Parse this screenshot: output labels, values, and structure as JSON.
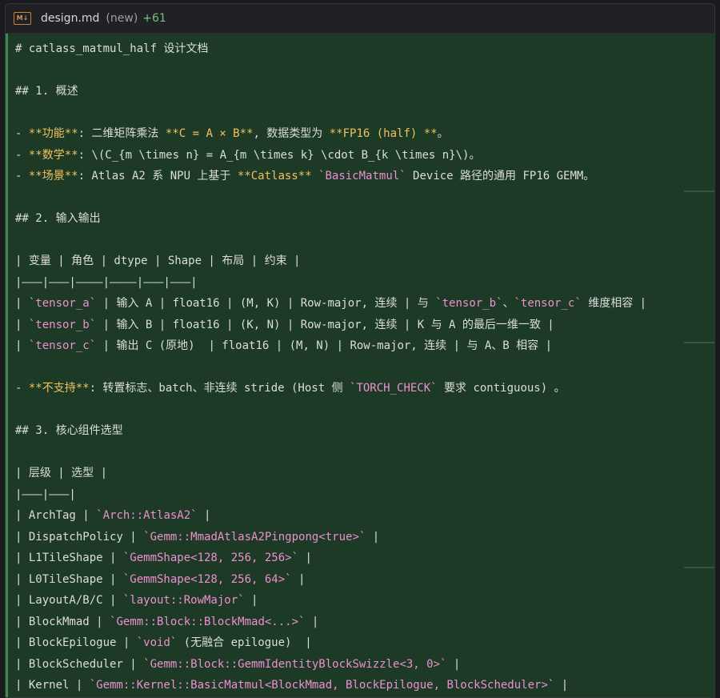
{
  "tab": {
    "filename": "design.md",
    "status": "(new)",
    "added": "+61"
  },
  "lines": [
    [
      {
        "t": "# catlass_matmul_half 设计文档"
      }
    ],
    [],
    [
      {
        "t": "## 1. 概述"
      }
    ],
    [],
    [
      {
        "t": "- "
      },
      {
        "t": "**功能**",
        "s": "b"
      },
      {
        "t": ": 二维矩阵乘法 "
      },
      {
        "t": "**C = A × B**",
        "s": "b"
      },
      {
        "t": ", 数据类型为 "
      },
      {
        "t": "**FP16 (half) **",
        "s": "b"
      },
      {
        "t": "。"
      }
    ],
    [
      {
        "t": "- "
      },
      {
        "t": "**数学**",
        "s": "b"
      },
      {
        "t": ": \\(C_{m \\times n} = A_{m \\times k} \\cdot B_{k \\times n}\\)。"
      }
    ],
    [
      {
        "t": "- "
      },
      {
        "t": "**场景**",
        "s": "b"
      },
      {
        "t": ": Atlas A2 系 NPU 上基于 "
      },
      {
        "t": "**Catlass**",
        "s": "b"
      },
      {
        "t": " "
      },
      {
        "t": "`BasicMatmul`",
        "s": "c"
      },
      {
        "t": " Device 路径的通用 FP16 GEMM。"
      }
    ],
    [],
    [
      {
        "t": "## 2. 输入输出"
      }
    ],
    [],
    [
      {
        "t": "| 变量 | 角色 | dtype | Shape | 布局 | 约束 |"
      }
    ],
    [
      {
        "t": "|———|———|————|————|———|———|"
      }
    ],
    [
      {
        "t": "| "
      },
      {
        "t": "`tensor_a`",
        "s": "c"
      },
      {
        "t": " | 输入 A | float16 | (M, K) | Row-major, 连续 | 与 "
      },
      {
        "t": "`tensor_b`",
        "s": "c"
      },
      {
        "t": "、"
      },
      {
        "t": "`tensor_c`",
        "s": "c"
      },
      {
        "t": " 维度相容 |"
      }
    ],
    [
      {
        "t": "| "
      },
      {
        "t": "`tensor_b`",
        "s": "c"
      },
      {
        "t": " | 输入 B | float16 | (K, N) | Row-major, 连续 | K 与 A 的最后一维一致 |"
      }
    ],
    [
      {
        "t": "| "
      },
      {
        "t": "`tensor_c`",
        "s": "c"
      },
      {
        "t": " | 输出 C (原地)  | float16 | (M, N) | Row-major, 连续 | 与 A、B 相容 |"
      }
    ],
    [],
    [
      {
        "t": "- "
      },
      {
        "t": "**不支持**",
        "s": "b"
      },
      {
        "t": ": 转置标志、batch、非连续 stride (Host 侧 "
      },
      {
        "t": "`TORCH_CHECK`",
        "s": "c"
      },
      {
        "t": " 要求 contiguous) 。"
      }
    ],
    [],
    [
      {
        "t": "## 3. 核心组件选型"
      }
    ],
    [],
    [
      {
        "t": "| 层级 | 选型 |"
      }
    ],
    [
      {
        "t": "|———|———|"
      }
    ],
    [
      {
        "t": "| ArchTag | "
      },
      {
        "t": "`Arch::AtlasA2`",
        "s": "c"
      },
      {
        "t": " |"
      }
    ],
    [
      {
        "t": "| DispatchPolicy | "
      },
      {
        "t": "`Gemm::MmadAtlasA2Pingpong<true>`",
        "s": "c"
      },
      {
        "t": " |"
      }
    ],
    [
      {
        "t": "| L1TileShape | "
      },
      {
        "t": "`GemmShape<128, 256, 256>`",
        "s": "c"
      },
      {
        "t": " |"
      }
    ],
    [
      {
        "t": "| L0TileShape | "
      },
      {
        "t": "`GemmShape<128, 256, 64>`",
        "s": "c"
      },
      {
        "t": " |"
      }
    ],
    [
      {
        "t": "| LayoutA/B/C | "
      },
      {
        "t": "`layout::RowMajor`",
        "s": "c"
      },
      {
        "t": " |"
      }
    ],
    [
      {
        "t": "| BlockMmad | "
      },
      {
        "t": "`Gemm::Block::BlockMmad<...>`",
        "s": "c"
      },
      {
        "t": " |"
      }
    ],
    [
      {
        "t": "| BlockEpilogue | "
      },
      {
        "t": "`void`",
        "s": "c"
      },
      {
        "t": " (无融合 epilogue)  |"
      }
    ],
    [
      {
        "t": "| BlockScheduler | "
      },
      {
        "t": "`Gemm::Block::GemmIdentityBlockSwizzle<3, 0>`",
        "s": "c"
      },
      {
        "t": " |"
      }
    ],
    [
      {
        "t": "| Kernel | "
      },
      {
        "t": "`Gemm::Kernel::BasicMatmul<BlockMmad, BlockEpilogue, BlockScheduler>`",
        "s": "c"
      },
      {
        "t": " |"
      }
    ]
  ]
}
